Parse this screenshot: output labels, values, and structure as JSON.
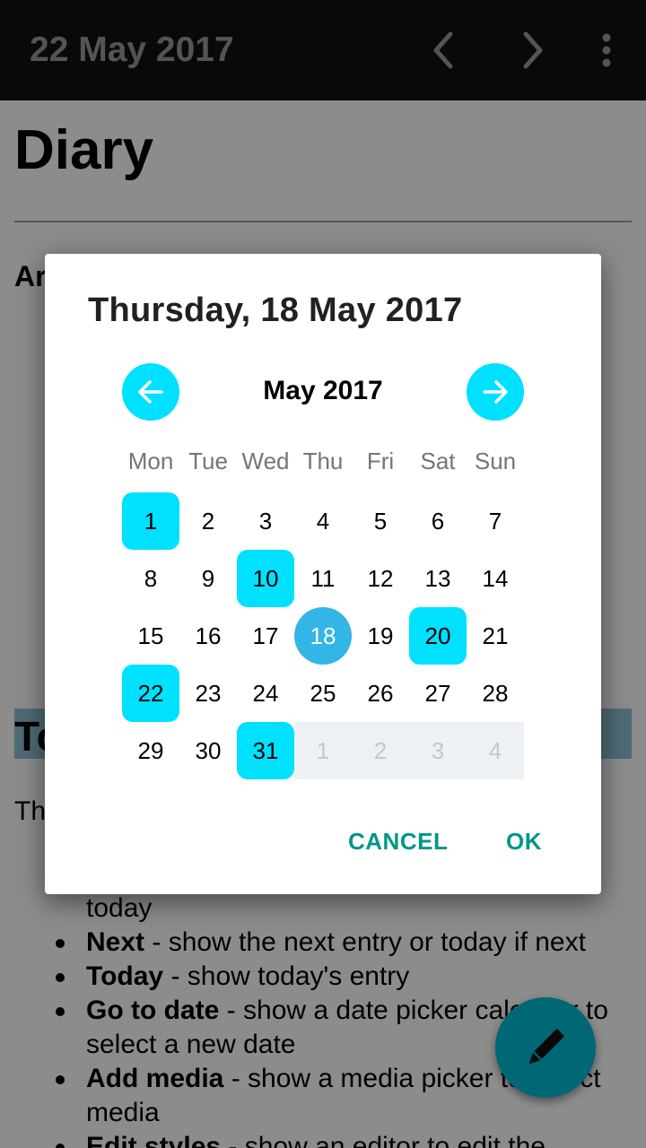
{
  "appbar": {
    "title": "22 May 2017",
    "prev_icon": "chevron-left-icon",
    "next_icon": "chevron-right-icon",
    "menu_icon": "more-vert-icon"
  },
  "page": {
    "title": "Diary",
    "fragment_ar": "Ar",
    "fragment_heading": "To",
    "fragment_th": "Th",
    "list": [
      {
        "bold": "",
        "rest": "today"
      },
      {
        "bold": "Next",
        "rest": " - show the next entry or today if next"
      },
      {
        "bold": "Today",
        "rest": " - show today's entry"
      },
      {
        "bold": "Go to date",
        "rest": " - show a date picker calendar to"
      },
      {
        "bold": "",
        "rest": "select a new date"
      },
      {
        "bold": "Add media",
        "rest": " - show a media picker to select"
      },
      {
        "bold": "",
        "rest": "media"
      },
      {
        "bold": "Edit styles",
        "rest": " - show an editor to edit the"
      }
    ]
  },
  "fab": {
    "icon": "pencil-icon"
  },
  "dialog": {
    "selected_date": "Thursday, 18 May 2017",
    "month_label": "May 2017",
    "weekdays": [
      "Mon",
      "Tue",
      "Wed",
      "Thu",
      "Fri",
      "Sat",
      "Sun"
    ],
    "weeks": [
      [
        "1",
        "2",
        "3",
        "4",
        "5",
        "6",
        "7"
      ],
      [
        "8",
        "9",
        "10",
        "11",
        "12",
        "13",
        "14"
      ],
      [
        "15",
        "16",
        "17",
        "18",
        "19",
        "20",
        "21"
      ],
      [
        "22",
        "23",
        "24",
        "25",
        "26",
        "27",
        "28"
      ],
      [
        "29",
        "30",
        "31",
        "1",
        "2",
        "3",
        "4"
      ]
    ],
    "entry_days": [
      "1",
      "10",
      "20",
      "22",
      "31"
    ],
    "selected_day": "18",
    "next_month_days": [
      "1",
      "2",
      "3",
      "4"
    ],
    "cancel_label": "CANCEL",
    "ok_label": "OK",
    "colors": {
      "accent": "#00e0ff",
      "selected": "#33b5e5",
      "action": "#009688"
    }
  }
}
